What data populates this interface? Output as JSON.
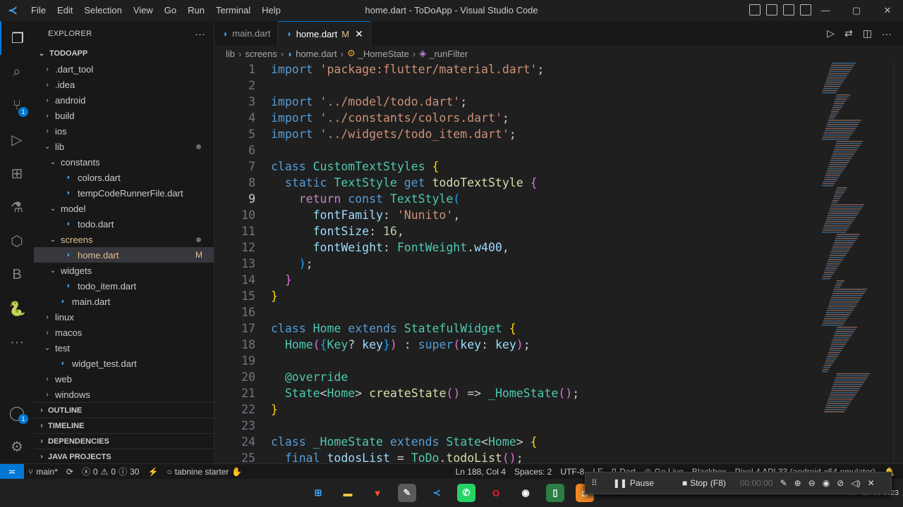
{
  "titlebar": {
    "menus": [
      "File",
      "Edit",
      "Selection",
      "View",
      "Go",
      "Run",
      "Terminal",
      "Help"
    ],
    "title": "home.dart - ToDoApp - Visual Studio Code",
    "window_controls": [
      "—",
      "▢",
      "✕"
    ]
  },
  "activity": {
    "items": [
      {
        "name": "explorer-icon",
        "glyph": "❐",
        "active": true
      },
      {
        "name": "search-icon",
        "glyph": "⌕"
      },
      {
        "name": "source-control-icon",
        "glyph": "⑂",
        "badge": "1"
      },
      {
        "name": "run-debug-icon",
        "glyph": "▷"
      },
      {
        "name": "extensions-icon",
        "glyph": "⊞"
      },
      {
        "name": "testing-icon",
        "glyph": "⚗"
      },
      {
        "name": "remote-explorer-icon",
        "glyph": "⬡"
      },
      {
        "name": "blackbox-icon",
        "glyph": "B"
      },
      {
        "name": "python-icon",
        "glyph": "🐍"
      },
      {
        "name": "more-icon",
        "glyph": "···"
      }
    ],
    "bottom": [
      {
        "name": "accounts-icon",
        "glyph": "◯",
        "badge": "1"
      },
      {
        "name": "manage-gear-icon",
        "glyph": "⚙"
      }
    ]
  },
  "sidebar": {
    "header": "EXPLORER",
    "more": "···",
    "tree": [
      {
        "label": "TODOAPP",
        "depth": 0,
        "type": "root",
        "open": true
      },
      {
        "label": ".dart_tool",
        "depth": 1,
        "type": "folder",
        "open": false
      },
      {
        "label": ".idea",
        "depth": 1,
        "type": "folder",
        "open": false
      },
      {
        "label": "android",
        "depth": 1,
        "type": "folder",
        "open": false
      },
      {
        "label": "build",
        "depth": 1,
        "type": "folder",
        "open": false
      },
      {
        "label": "ios",
        "depth": 1,
        "type": "folder",
        "open": false
      },
      {
        "label": "lib",
        "depth": 1,
        "type": "folder",
        "open": true,
        "dot": true
      },
      {
        "label": "constants",
        "depth": 2,
        "type": "folder",
        "open": true
      },
      {
        "label": "colors.dart",
        "depth": 3,
        "type": "file"
      },
      {
        "label": "tempCodeRunnerFile.dart",
        "depth": 3,
        "type": "file"
      },
      {
        "label": "model",
        "depth": 2,
        "type": "folder",
        "open": true
      },
      {
        "label": "todo.dart",
        "depth": 3,
        "type": "file"
      },
      {
        "label": "screens",
        "depth": 2,
        "type": "folder",
        "open": true,
        "dot": true,
        "modified": true
      },
      {
        "label": "home.dart",
        "depth": 3,
        "type": "file",
        "selected": true,
        "mark": "M",
        "modified": true
      },
      {
        "label": "widgets",
        "depth": 2,
        "type": "folder",
        "open": true
      },
      {
        "label": "todo_item.dart",
        "depth": 3,
        "type": "file"
      },
      {
        "label": "main.dart",
        "depth": 2,
        "type": "file"
      },
      {
        "label": "linux",
        "depth": 1,
        "type": "folder",
        "open": false
      },
      {
        "label": "macos",
        "depth": 1,
        "type": "folder",
        "open": false
      },
      {
        "label": "test",
        "depth": 1,
        "type": "folder",
        "open": true
      },
      {
        "label": "widget_test.dart",
        "depth": 2,
        "type": "file"
      },
      {
        "label": "web",
        "depth": 1,
        "type": "folder",
        "open": false
      },
      {
        "label": "windows",
        "depth": 1,
        "type": "folder",
        "open": false
      }
    ],
    "sections": [
      "OUTLINE",
      "TIMELINE",
      "DEPENDENCIES",
      "JAVA PROJECTS"
    ]
  },
  "tabs": [
    {
      "label": "main.dart",
      "active": false
    },
    {
      "label": "home.dart",
      "active": true,
      "mod": "M",
      "close": "✕"
    }
  ],
  "editor_actions": [
    "▷",
    "⇄",
    "◫",
    "···"
  ],
  "breadcrumb": [
    "lib",
    "screens",
    "home.dart",
    "_HomeState",
    "_runFilter"
  ],
  "code": {
    "current_line": 9,
    "lines": [
      [
        {
          "t": "import ",
          "c": "kw"
        },
        {
          "t": "'package:flutter/material.dart'",
          "c": "str"
        },
        {
          "t": ";",
          "c": ""
        }
      ],
      [],
      [
        {
          "t": "import ",
          "c": "kw"
        },
        {
          "t": "'../model/todo.dart'",
          "c": "str"
        },
        {
          "t": ";",
          "c": ""
        }
      ],
      [
        {
          "t": "import ",
          "c": "kw"
        },
        {
          "t": "'../constants/colors.dart'",
          "c": "str"
        },
        {
          "t": ";",
          "c": ""
        }
      ],
      [
        {
          "t": "import ",
          "c": "kw"
        },
        {
          "t": "'../widgets/todo_item.dart'",
          "c": "str"
        },
        {
          "t": ";",
          "c": ""
        }
      ],
      [],
      [
        {
          "t": "class ",
          "c": "kw"
        },
        {
          "t": "CustomTextStyles ",
          "c": "cls"
        },
        {
          "t": "{",
          "c": "b1"
        }
      ],
      [
        {
          "t": "  static ",
          "c": "kw"
        },
        {
          "t": "TextStyle ",
          "c": "cls"
        },
        {
          "t": "get ",
          "c": "kw"
        },
        {
          "t": "todoTextStyle ",
          "c": "fn"
        },
        {
          "t": "{",
          "c": "b2"
        }
      ],
      [
        {
          "t": "    return ",
          "c": "ctl"
        },
        {
          "t": "const ",
          "c": "kw"
        },
        {
          "t": "TextStyle",
          "c": "cls"
        },
        {
          "t": "(",
          "c": "b3"
        }
      ],
      [
        {
          "t": "      fontFamily",
          "c": "var"
        },
        {
          "t": ": ",
          "c": ""
        },
        {
          "t": "'Nunito'",
          "c": "str"
        },
        {
          "t": ",",
          "c": ""
        }
      ],
      [
        {
          "t": "      fontSize",
          "c": "var"
        },
        {
          "t": ": ",
          "c": ""
        },
        {
          "t": "16",
          "c": "num"
        },
        {
          "t": ",",
          "c": ""
        }
      ],
      [
        {
          "t": "      fontWeight",
          "c": "var"
        },
        {
          "t": ": ",
          "c": ""
        },
        {
          "t": "FontWeight",
          "c": "cls"
        },
        {
          "t": ".",
          "c": ""
        },
        {
          "t": "w400",
          "c": "var"
        },
        {
          "t": ",",
          "c": ""
        }
      ],
      [
        {
          "t": "    )",
          "c": "b3"
        },
        {
          "t": ";",
          "c": ""
        }
      ],
      [
        {
          "t": "  }",
          "c": "b2"
        }
      ],
      [
        {
          "t": "}",
          "c": "b1"
        }
      ],
      [],
      [
        {
          "t": "class ",
          "c": "kw"
        },
        {
          "t": "Home ",
          "c": "cls"
        },
        {
          "t": "extends ",
          "c": "kw"
        },
        {
          "t": "StatefulWidget ",
          "c": "cls"
        },
        {
          "t": "{",
          "c": "b1"
        }
      ],
      [
        {
          "t": "  Home",
          "c": "cls"
        },
        {
          "t": "(",
          "c": "b2"
        },
        {
          "t": "{",
          "c": "b3"
        },
        {
          "t": "Key",
          "c": "cls"
        },
        {
          "t": "? ",
          "c": ""
        },
        {
          "t": "key",
          "c": "var"
        },
        {
          "t": "}",
          "c": "b3"
        },
        {
          "t": ")",
          "c": "b2"
        },
        {
          "t": " : ",
          "c": ""
        },
        {
          "t": "super",
          "c": "kw"
        },
        {
          "t": "(",
          "c": "b2"
        },
        {
          "t": "key",
          "c": "var"
        },
        {
          "t": ": ",
          "c": ""
        },
        {
          "t": "key",
          "c": "var"
        },
        {
          "t": ")",
          "c": "b2"
        },
        {
          "t": ";",
          "c": ""
        }
      ],
      [],
      [
        {
          "t": "  @override",
          "c": "ann"
        }
      ],
      [
        {
          "t": "  State",
          "c": "cls"
        },
        {
          "t": "<",
          "c": ""
        },
        {
          "t": "Home",
          "c": "cls"
        },
        {
          "t": "> ",
          "c": ""
        },
        {
          "t": "createState",
          "c": "fn"
        },
        {
          "t": "()",
          "c": "b2"
        },
        {
          "t": " => ",
          "c": ""
        },
        {
          "t": "_HomeState",
          "c": "cls"
        },
        {
          "t": "()",
          "c": "b2"
        },
        {
          "t": ";",
          "c": ""
        }
      ],
      [
        {
          "t": "}",
          "c": "b1"
        }
      ],
      [],
      [
        {
          "t": "class ",
          "c": "kw"
        },
        {
          "t": "_HomeState ",
          "c": "cls"
        },
        {
          "t": "extends ",
          "c": "kw"
        },
        {
          "t": "State",
          "c": "cls"
        },
        {
          "t": "<",
          "c": ""
        },
        {
          "t": "Home",
          "c": "cls"
        },
        {
          "t": "> ",
          "c": ""
        },
        {
          "t": "{",
          "c": "b1"
        }
      ],
      [
        {
          "t": "  final ",
          "c": "kw"
        },
        {
          "t": "todosList ",
          "c": "var"
        },
        {
          "t": "= ",
          "c": ""
        },
        {
          "t": "ToDo",
          "c": "cls"
        },
        {
          "t": ".",
          "c": ""
        },
        {
          "t": "todoList",
          "c": "fn"
        },
        {
          "t": "()",
          "c": "b2"
        },
        {
          "t": ";",
          "c": ""
        }
      ]
    ]
  },
  "statusbar": {
    "remote": "≍",
    "branch": "main*",
    "sync": "⟳",
    "errors": "0",
    "warnings": "0",
    "info": "30",
    "flash": "⚡",
    "tabnine": "tabnine starter",
    "position": "Ln 188, Col 4",
    "spaces": "Spaces: 2",
    "encoding": "UTF-8",
    "eol": "LF",
    "language": "Dart",
    "golive": "Go Live",
    "blackbox": "Blackbox",
    "device": "Pixel 4 API 33 (android-x64 emulator)"
  },
  "debugbar": {
    "pause": "Pause",
    "stop": "Stop",
    "stop_key": "(F8)",
    "timer": "00:00:00"
  },
  "taskbar": {
    "apps": [
      {
        "name": "windows-start-icon",
        "glyph": "⊞",
        "color": "#3aa0f3",
        "bg": "transparent"
      },
      {
        "name": "file-explorer-icon",
        "glyph": "▬",
        "color": "#f4c542",
        "bg": "transparent"
      },
      {
        "name": "brave-icon",
        "glyph": "▼",
        "color": "#fb542b",
        "bg": "transparent"
      },
      {
        "name": "notepad-icon",
        "glyph": "✎",
        "color": "#e0e0e0",
        "bg": "#5a5a5a"
      },
      {
        "name": "vscode-icon",
        "glyph": "≺",
        "color": "#2ca0f0",
        "bg": "transparent"
      },
      {
        "name": "whatsapp-icon",
        "glyph": "✆",
        "color": "#ffffff",
        "bg": "#25d366"
      },
      {
        "name": "opera-icon",
        "glyph": "O",
        "color": "#ff1b2d",
        "bg": "transparent"
      },
      {
        "name": "github-icon",
        "glyph": "◉",
        "color": "#ffffff",
        "bg": "transparent"
      },
      {
        "name": "app-icon",
        "glyph": "▯",
        "color": "#ffffff",
        "bg": "#2d7d46"
      },
      {
        "name": "recorder-icon",
        "glyph": "◘",
        "color": "#ffffff",
        "bg": "#f08a24"
      }
    ],
    "lang": "IN",
    "date": "29-08-2023"
  }
}
